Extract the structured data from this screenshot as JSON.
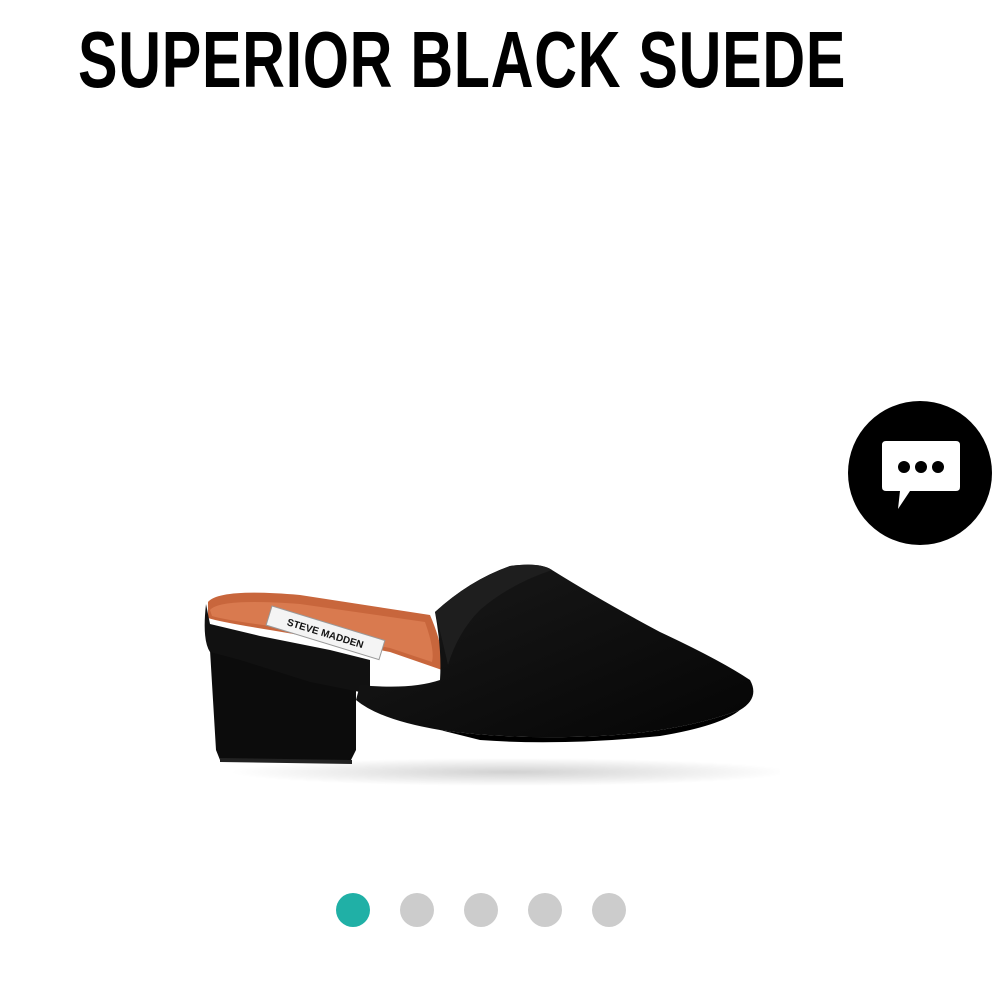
{
  "product": {
    "title": "SUPERIOR BLACK SUEDE",
    "insole_brand": "STEVE MADDEN"
  },
  "chat": {
    "icon": "chat-bubble-icon"
  },
  "carousel": {
    "total": 5,
    "active_index": 0,
    "active_color": "#20b0a6",
    "inactive_color": "#cccccc"
  }
}
